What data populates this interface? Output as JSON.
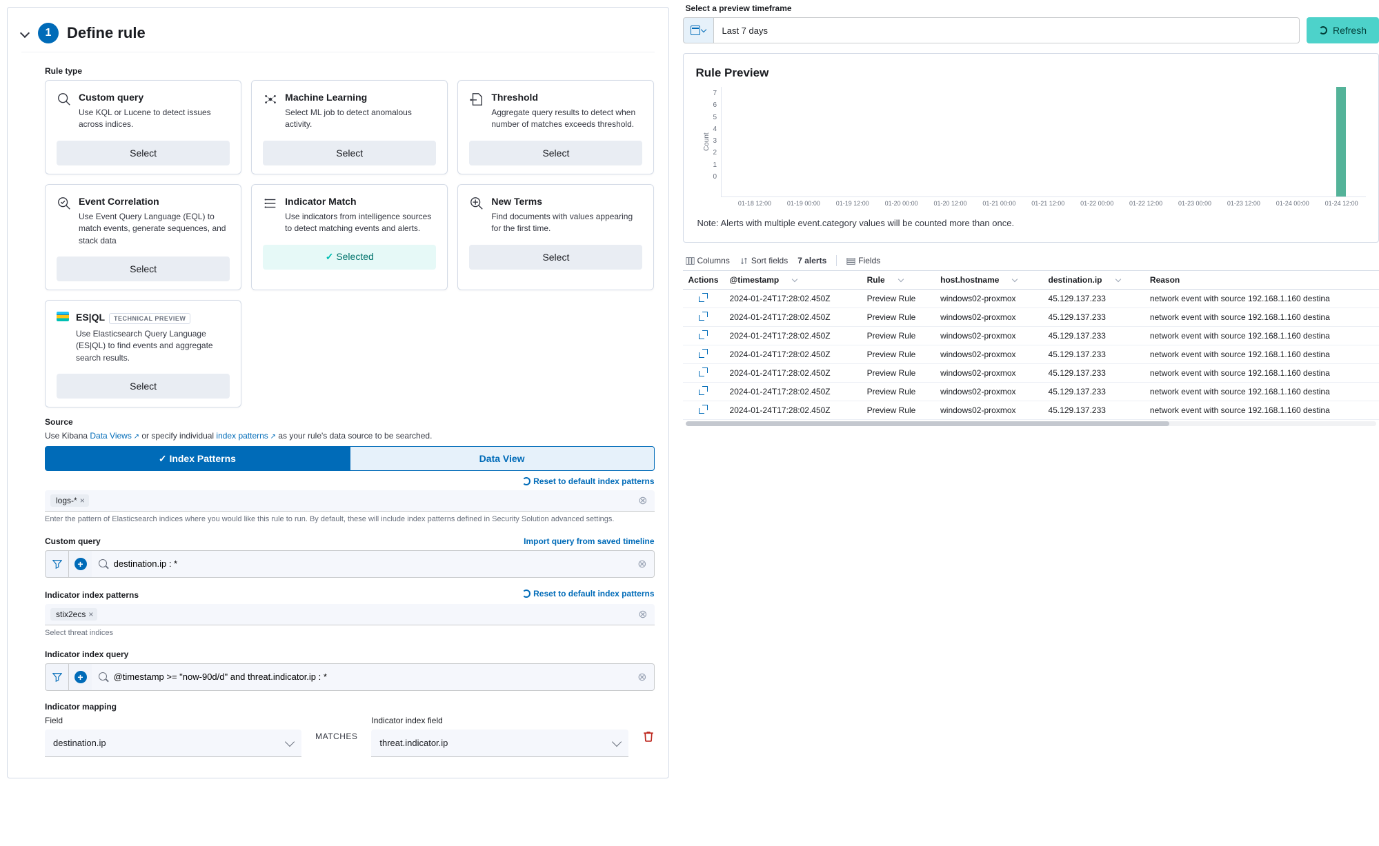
{
  "step": {
    "number": "1",
    "title": "Define rule"
  },
  "ruleTypeLabel": "Rule type",
  "ruleTypes": [
    {
      "name": "Custom query",
      "desc": "Use KQL or Lucene to detect issues across indices.",
      "button": "Select"
    },
    {
      "name": "Machine Learning",
      "desc": "Select ML job to detect anomalous activity.",
      "button": "Select"
    },
    {
      "name": "Threshold",
      "desc": "Aggregate query results to detect when number of matches exceeds threshold.",
      "button": "Select"
    },
    {
      "name": "Event Correlation",
      "desc": "Use Event Query Language (EQL) to match events, generate sequences, and stack data",
      "button": "Select"
    },
    {
      "name": "Indicator Match",
      "desc": "Use indicators from intelligence sources to detect matching events and alerts.",
      "button": "Selected",
      "selected": true
    },
    {
      "name": "New Terms",
      "desc": "Find documents with values appearing for the first time.",
      "button": "Select"
    },
    {
      "name": "ES|QL",
      "badge": "TECHNICAL PREVIEW",
      "desc": "Use Elasticsearch Query Language (ES|QL) to find events and aggregate search results.",
      "button": "Select"
    }
  ],
  "source": {
    "label": "Source",
    "desc_prefix": "Use Kibana ",
    "link1": "Data Views",
    "desc_mid": " or specify individual ",
    "link2": "index patterns",
    "desc_suffix": " as your rule's data source to be searched.",
    "tabIndex": "Index Patterns",
    "tabDataView": "Data View",
    "resetLink": "Reset to default index patterns",
    "tag": "logs-*",
    "help": "Enter the pattern of Elasticsearch indices where you would like this rule to run. By default, these will include index patterns defined in Security Solution advanced settings."
  },
  "customQuery": {
    "label": "Custom query",
    "importLink": "Import query from saved timeline",
    "value": "destination.ip : *"
  },
  "indIndex": {
    "label": "Indicator index patterns",
    "resetLink": "Reset to default index patterns",
    "tag": "stix2ecs",
    "help": "Select threat indices"
  },
  "indQuery": {
    "label": "Indicator index query",
    "value": "@timestamp >= \"now-90d/d\" and threat.indicator.ip : *"
  },
  "mapping": {
    "sectionLabel": "Indicator mapping",
    "fieldLabel": "Field",
    "fieldValue": "destination.ip",
    "matches": "MATCHES",
    "indexFieldLabel": "Indicator index field",
    "indexFieldValue": "threat.indicator.ip"
  },
  "preview": {
    "selectLabel": "Select a preview timeframe",
    "range": "Last 7 days",
    "refresh": "Refresh",
    "title": "Rule Preview",
    "note": "Note: Alerts with multiple event.category values will be counted more than once.",
    "toolbar": {
      "columns": "Columns",
      "sort": "Sort fields",
      "alerts": "7 alerts",
      "fields": "Fields"
    },
    "headers": {
      "actions": "Actions",
      "ts": "@timestamp",
      "rule": "Rule",
      "host": "host.hostname",
      "dest": "destination.ip",
      "reason": "Reason"
    }
  },
  "chart_data": {
    "type": "bar",
    "title": "",
    "ylabel": "Count",
    "xlabel": "",
    "ylim": [
      0,
      7
    ],
    "y_ticks": [
      0,
      1,
      2,
      3,
      4,
      5,
      6,
      7
    ],
    "x_tick_labels": [
      "01-18 12:00",
      "01-19 00:00",
      "01-19 12:00",
      "01-20 00:00",
      "01-20 12:00",
      "01-21 00:00",
      "01-21 12:00",
      "01-22 00:00",
      "01-22 12:00",
      "01-23 00:00",
      "01-23 12:00",
      "01-24 00:00",
      "01-24 12:00"
    ],
    "bars": [
      {
        "x_label": "01-24 12:00",
        "value": 7
      }
    ]
  },
  "rows": [
    {
      "ts": "2024-01-24T17:28:02.450Z",
      "rule": "Preview Rule",
      "host": "windows02-proxmox",
      "dest": "45.129.137.233",
      "reason": "network event with source 192.168.1.160 destina"
    },
    {
      "ts": "2024-01-24T17:28:02.450Z",
      "rule": "Preview Rule",
      "host": "windows02-proxmox",
      "dest": "45.129.137.233",
      "reason": "network event with source 192.168.1.160 destina"
    },
    {
      "ts": "2024-01-24T17:28:02.450Z",
      "rule": "Preview Rule",
      "host": "windows02-proxmox",
      "dest": "45.129.137.233",
      "reason": "network event with source 192.168.1.160 destina"
    },
    {
      "ts": "2024-01-24T17:28:02.450Z",
      "rule": "Preview Rule",
      "host": "windows02-proxmox",
      "dest": "45.129.137.233",
      "reason": "network event with source 192.168.1.160 destina"
    },
    {
      "ts": "2024-01-24T17:28:02.450Z",
      "rule": "Preview Rule",
      "host": "windows02-proxmox",
      "dest": "45.129.137.233",
      "reason": "network event with source 192.168.1.160 destina"
    },
    {
      "ts": "2024-01-24T17:28:02.450Z",
      "rule": "Preview Rule",
      "host": "windows02-proxmox",
      "dest": "45.129.137.233",
      "reason": "network event with source 192.168.1.160 destina"
    },
    {
      "ts": "2024-01-24T17:28:02.450Z",
      "rule": "Preview Rule",
      "host": "windows02-proxmox",
      "dest": "45.129.137.233",
      "reason": "network event with source 192.168.1.160 destina"
    }
  ]
}
